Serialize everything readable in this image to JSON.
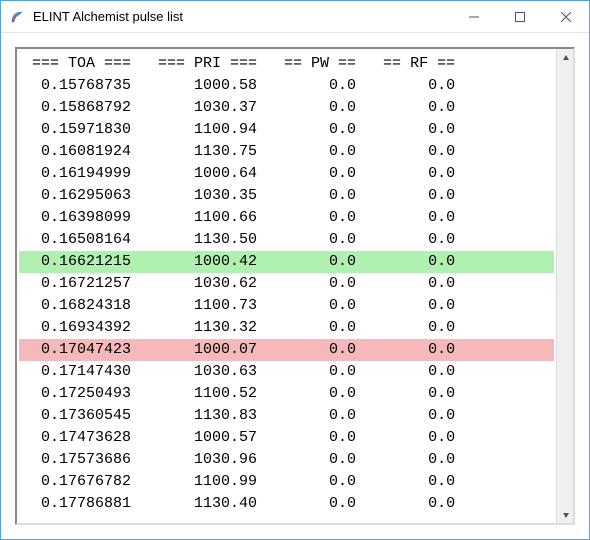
{
  "window": {
    "title": "ELINT Alchemist pulse list"
  },
  "columns": {
    "toa": "=== TOA ===",
    "pri": "=== PRI ===",
    "pw": "== PW ==",
    "rf": "== RF =="
  },
  "rows": [
    {
      "toa": "0.15768735",
      "pri": "1000.58",
      "pw": "0.0",
      "rf": "0.0",
      "hl": ""
    },
    {
      "toa": "0.15868792",
      "pri": "1030.37",
      "pw": "0.0",
      "rf": "0.0",
      "hl": ""
    },
    {
      "toa": "0.15971830",
      "pri": "1100.94",
      "pw": "0.0",
      "rf": "0.0",
      "hl": ""
    },
    {
      "toa": "0.16081924",
      "pri": "1130.75",
      "pw": "0.0",
      "rf": "0.0",
      "hl": ""
    },
    {
      "toa": "0.16194999",
      "pri": "1000.64",
      "pw": "0.0",
      "rf": "0.0",
      "hl": ""
    },
    {
      "toa": "0.16295063",
      "pri": "1030.35",
      "pw": "0.0",
      "rf": "0.0",
      "hl": ""
    },
    {
      "toa": "0.16398099",
      "pri": "1100.66",
      "pw": "0.0",
      "rf": "0.0",
      "hl": ""
    },
    {
      "toa": "0.16508164",
      "pri": "1130.50",
      "pw": "0.0",
      "rf": "0.0",
      "hl": ""
    },
    {
      "toa": "0.16621215",
      "pri": "1000.42",
      "pw": "0.0",
      "rf": "0.0",
      "hl": "green"
    },
    {
      "toa": "0.16721257",
      "pri": "1030.62",
      "pw": "0.0",
      "rf": "0.0",
      "hl": ""
    },
    {
      "toa": "0.16824318",
      "pri": "1100.73",
      "pw": "0.0",
      "rf": "0.0",
      "hl": ""
    },
    {
      "toa": "0.16934392",
      "pri": "1130.32",
      "pw": "0.0",
      "rf": "0.0",
      "hl": ""
    },
    {
      "toa": "0.17047423",
      "pri": "1000.07",
      "pw": "0.0",
      "rf": "0.0",
      "hl": "red"
    },
    {
      "toa": "0.17147430",
      "pri": "1030.63",
      "pw": "0.0",
      "rf": "0.0",
      "hl": ""
    },
    {
      "toa": "0.17250493",
      "pri": "1100.52",
      "pw": "0.0",
      "rf": "0.0",
      "hl": ""
    },
    {
      "toa": "0.17360545",
      "pri": "1130.83",
      "pw": "0.0",
      "rf": "0.0",
      "hl": ""
    },
    {
      "toa": "0.17473628",
      "pri": "1000.57",
      "pw": "0.0",
      "rf": "0.0",
      "hl": ""
    },
    {
      "toa": "0.17573686",
      "pri": "1030.96",
      "pw": "0.0",
      "rf": "0.0",
      "hl": ""
    },
    {
      "toa": "0.17676782",
      "pri": "1100.99",
      "pw": "0.0",
      "rf": "0.0",
      "hl": ""
    },
    {
      "toa": "0.17786881",
      "pri": "1130.40",
      "pw": "0.0",
      "rf": "0.0",
      "hl": ""
    }
  ]
}
